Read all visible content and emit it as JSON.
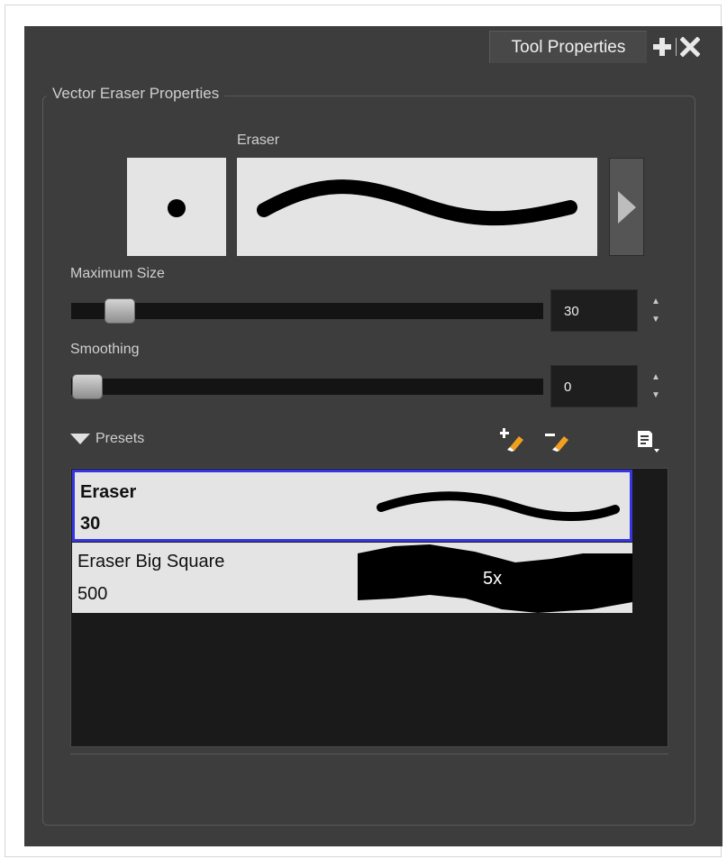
{
  "tab": {
    "title": "Tool Properties",
    "plus_icon": "plus-icon",
    "close_icon": "close-icon"
  },
  "group_title": "Vector Eraser Properties",
  "eraser_label": "Eraser",
  "max_size": {
    "label": "Maximum Size",
    "value": "30",
    "slider_fraction": 0.05
  },
  "smoothing": {
    "label": "Smoothing",
    "value": "0",
    "slider_fraction": 0.0
  },
  "presets": {
    "label": "Presets",
    "icons": [
      "new-preset-icon",
      "delete-preset-icon",
      "preset-menu-icon"
    ],
    "items": [
      {
        "name": "Eraser",
        "size": "30",
        "selected": true
      },
      {
        "name": "Eraser Big Square",
        "size": "500",
        "magnification": "5x",
        "selected": false
      }
    ]
  },
  "colors": {
    "panel": "#3d3d3d",
    "selection": "#3535e6",
    "preview_bg": "#e4e4e4"
  }
}
